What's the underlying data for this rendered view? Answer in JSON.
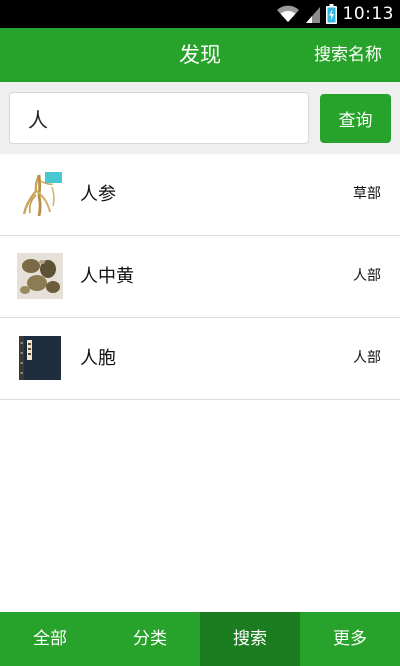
{
  "status_bar": {
    "time": "10:13",
    "icons": [
      "wifi-icon",
      "signal-icon",
      "battery-charging-icon"
    ]
  },
  "header": {
    "title": "发现",
    "action_label": "搜索名称"
  },
  "search": {
    "value": "人",
    "button_label": "查询"
  },
  "results": [
    {
      "name": "人参",
      "category": "草部",
      "thumbnail": "ginseng-image"
    },
    {
      "name": "人中黄",
      "category": "人部",
      "thumbnail": "herb-lumps-image"
    },
    {
      "name": "人胞",
      "category": "人部",
      "thumbnail": "book-cover-image"
    }
  ],
  "tabs": [
    {
      "label": "全部",
      "active": false
    },
    {
      "label": "分类",
      "active": false
    },
    {
      "label": "搜索",
      "active": true
    },
    {
      "label": "更多",
      "active": false
    }
  ],
  "colors": {
    "brand_green": "#27a22a",
    "active_tab": "#1b7d1f",
    "status_bar": "#000000",
    "search_area": "#efefef"
  }
}
